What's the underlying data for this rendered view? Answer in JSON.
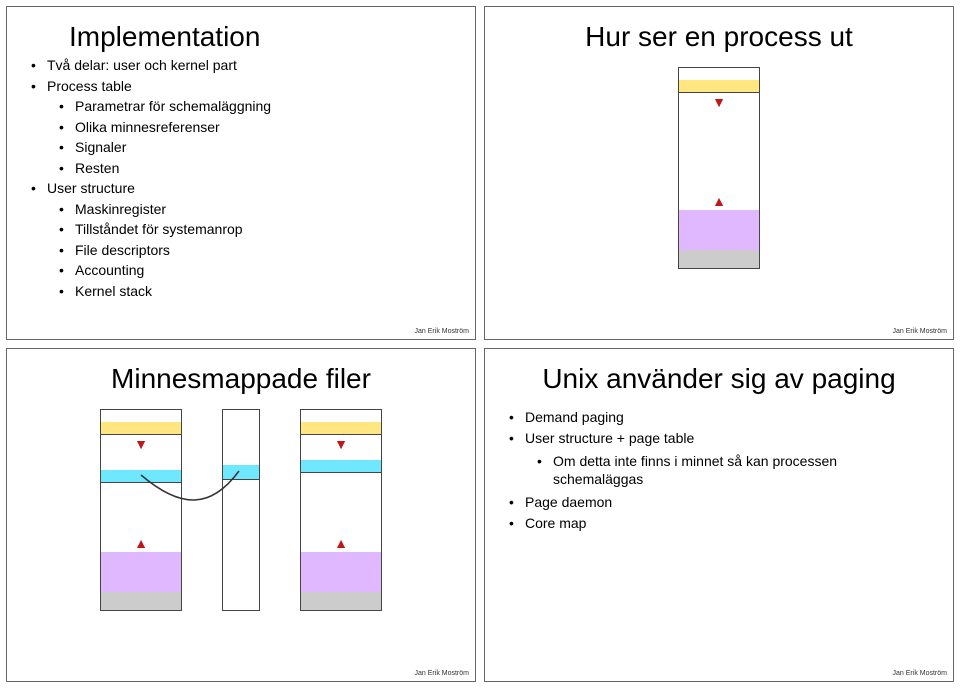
{
  "author": "Jan Erik Moström",
  "slides": {
    "s1": {
      "title": "Implementation",
      "items": [
        "Två delar: user och kernel part",
        "Process table",
        "Parametrar för schemaläggning",
        "Olika minnesreferenser",
        "Signaler",
        "Resten",
        "User structure",
        "Maskinregister",
        "Tillståndet för systemanrop",
        "File descriptors",
        "Accounting",
        "Kernel stack"
      ]
    },
    "s2": {
      "title": "Hur ser en process ut"
    },
    "s3": {
      "title": "Minnesmappade filer"
    },
    "s4": {
      "title": "Unix använder sig av paging",
      "b1": "Demand paging",
      "b2": "User structure + page table",
      "b2a": "Om detta inte finns i minnet så kan processen schemaläggas",
      "b3": "Page daemon",
      "b4": "Core map"
    }
  }
}
